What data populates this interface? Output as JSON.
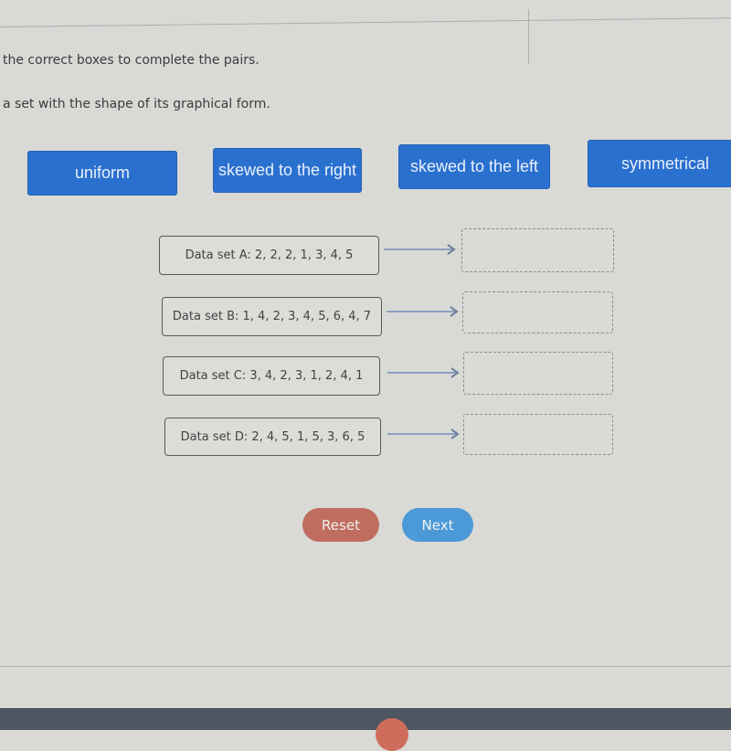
{
  "instructions": {
    "line1": "the correct boxes to complete the pairs.",
    "line2": "a set with the shape of its graphical form."
  },
  "tiles": [
    {
      "label": "uniform"
    },
    {
      "label": "skewed to the right"
    },
    {
      "label": "skewed to the left"
    },
    {
      "label": "symmetrical"
    }
  ],
  "data_sets": [
    {
      "label": "Data set A: 2, 2, 2, 1, 3, 4, 5",
      "answer": ""
    },
    {
      "label": "Data set B: 1, 4, 2, 3, 4, 5, 6, 4, 7",
      "answer": ""
    },
    {
      "label": "Data set C: 3, 4, 2, 3, 1, 2, 4, 1",
      "answer": ""
    },
    {
      "label": "Data set D: 2, 4, 5, 1, 5, 3, 6, 5",
      "answer": ""
    }
  ],
  "buttons": {
    "reset": "Reset",
    "next": "Next"
  },
  "colors": {
    "tile_blue": "#2a70cf",
    "reset_red": "#c06d5f",
    "next_blue": "#4c99d8",
    "arrow": "#8c9fc2"
  },
  "icons": {
    "arrow": "right-arrow-icon"
  }
}
